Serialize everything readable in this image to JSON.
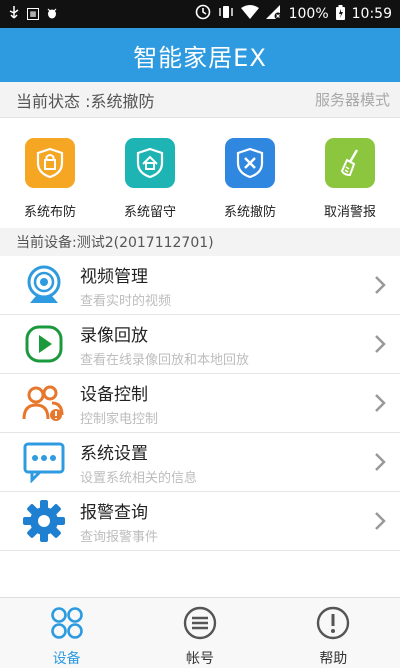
{
  "status_bar": {
    "left_icons": [
      "usb-icon",
      "sim-icon",
      "debug-icon"
    ],
    "battery_percent": "100%",
    "time": "10:59"
  },
  "header": {
    "title": "智能家居EX"
  },
  "state_bar": {
    "label": "当前状态 :系统撤防",
    "mode": "服务器模式"
  },
  "actions": [
    {
      "label": "系统布防",
      "color": "#f5a623",
      "icon": "shield-lock-icon"
    },
    {
      "label": "系统留守",
      "color": "#1fb4b4",
      "icon": "shield-home-icon"
    },
    {
      "label": "系统撤防",
      "color": "#2f87e0",
      "icon": "shield-x-icon"
    },
    {
      "label": "取消警报",
      "color": "#8cc63f",
      "icon": "broom-icon"
    }
  ],
  "device_bar": {
    "label": "当前设备:测试2(2017112701)"
  },
  "menu": [
    {
      "title": "视频管理",
      "sub": "查看实时的视频",
      "icon": "camera-icon"
    },
    {
      "title": "录像回放",
      "sub": "查看在线录像回放和本地回放",
      "icon": "play-icon"
    },
    {
      "title": "设备控制",
      "sub": "控制家电控制",
      "icon": "users-icon"
    },
    {
      "title": "系统设置",
      "sub": "设置系统相关的信息",
      "icon": "chat-icon"
    },
    {
      "title": "报警查询",
      "sub": "查询报警事件",
      "icon": "gear-icon"
    }
  ],
  "tabs": [
    {
      "label": "设备",
      "icon": "grid-icon",
      "active": true
    },
    {
      "label": "帐号",
      "icon": "list-icon",
      "active": false
    },
    {
      "label": "帮助",
      "icon": "help-icon",
      "active": false
    }
  ],
  "colors": {
    "accent": "#2e9be0",
    "play": "#1a9a3c",
    "control": "#e8772e"
  }
}
